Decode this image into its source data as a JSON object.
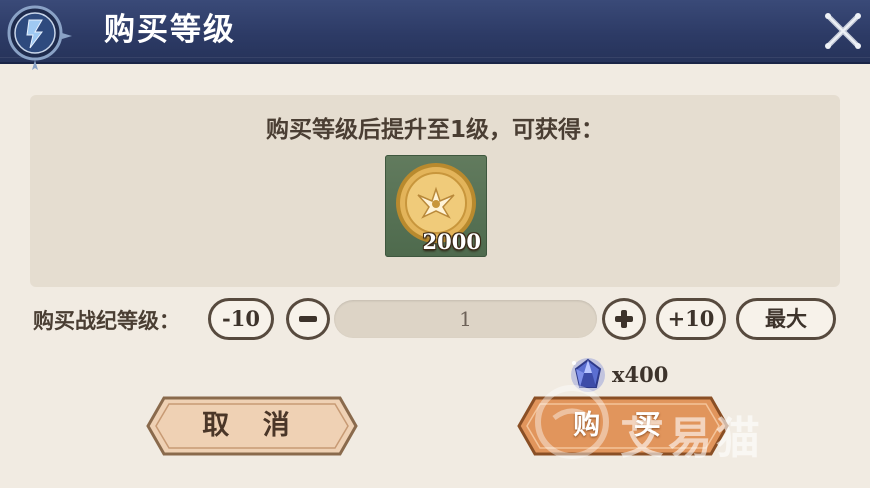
{
  "dialog": {
    "title": "购买等级",
    "reward_heading": "购买等级后提升至1级，可获得：",
    "reward": {
      "icon": "gold-coin-icon",
      "count": "2000"
    },
    "quantity": {
      "label": "购买战纪等级：",
      "minus10_label": "-10",
      "plus10_label": "+10",
      "max_label": "最大",
      "value": "1"
    },
    "cost": {
      "icon": "crystal-gem-icon",
      "amount": "x400"
    },
    "cancel_label": "取 消",
    "buy_label": "购 买",
    "watermark": "艾易猫"
  },
  "colors": {
    "title_bar": "#2d3b66",
    "background": "#f1ebe2",
    "panel": "#e5ddd0",
    "buy_button": "#e1955c",
    "cancel_button": "#efd1b4"
  }
}
